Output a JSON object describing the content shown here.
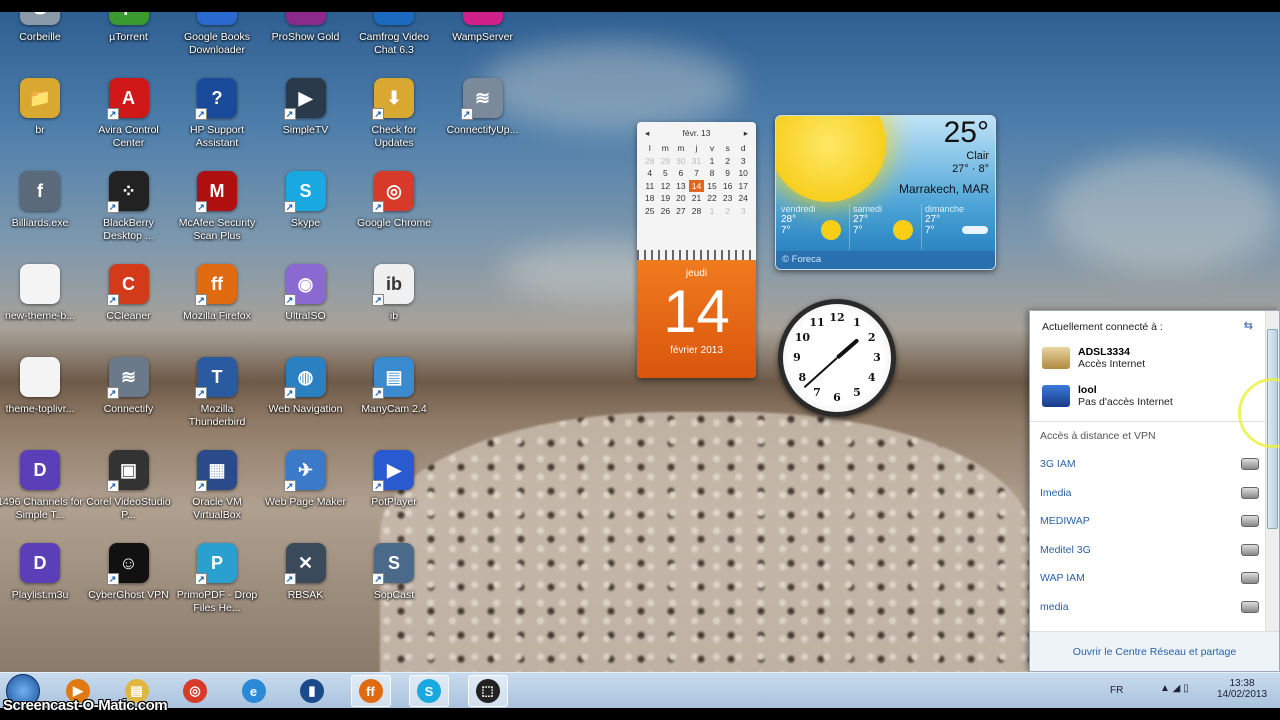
{
  "desktop": {
    "columns": [
      [
        {
          "label": "Corbeille",
          "glyph": "🗑",
          "color": "#8a9aa8"
        },
        {
          "label": "br",
          "glyph": "📁",
          "color": "#d9a830"
        },
        {
          "label": "Billiards.exe",
          "glyph": "f",
          "color": "#5a6a7a"
        },
        {
          "label": "new-theme-b...",
          "glyph": "",
          "color": "#f4f4f4"
        },
        {
          "label": "theme-toplivr...",
          "glyph": "",
          "color": "#f4f4f4"
        },
        {
          "label": "1496 Channels for Simple T...",
          "glyph": "D",
          "color": "#5b3fb8"
        },
        {
          "label": "Playlist.m3u",
          "glyph": "D",
          "color": "#5b3fb8"
        }
      ],
      [
        {
          "label": "µTorrent",
          "glyph": "µ",
          "color": "#3a9a30"
        },
        {
          "label": "Avira Control Center",
          "glyph": "A",
          "color": "#d01818"
        },
        {
          "label": "BlackBerry Desktop ...",
          "glyph": "⁘",
          "color": "#222"
        },
        {
          "label": "CCleaner",
          "glyph": "C",
          "color": "#d23a1a"
        },
        {
          "label": "Connectify",
          "glyph": "≋",
          "color": "#6a7a8a"
        },
        {
          "label": "Corel VideoStudio P...",
          "glyph": "▣",
          "color": "#333"
        },
        {
          "label": "CyberGhost VPN",
          "glyph": "☺",
          "color": "#111"
        }
      ],
      [
        {
          "label": "Google Books Downloader",
          "glyph": "G",
          "color": "#2a6ad0"
        },
        {
          "label": "HP Support Assistant",
          "glyph": "?",
          "color": "#1a4a9a"
        },
        {
          "label": "McAfee Security Scan Plus",
          "glyph": "M",
          "color": "#b01010"
        },
        {
          "label": "Mozilla Firefox",
          "glyph": "ff",
          "color": "#e06a10"
        },
        {
          "label": "Mozilla Thunderbird",
          "glyph": "T",
          "color": "#2a5aa0"
        },
        {
          "label": "Oracle VM VirtualBox",
          "glyph": "▦",
          "color": "#2a4a8a"
        },
        {
          "label": "PrimoPDF - Drop Files He...",
          "glyph": "P",
          "color": "#2aa0d0"
        }
      ],
      [
        {
          "label": "ProShow Gold",
          "glyph": "P",
          "color": "#8a2a8a"
        },
        {
          "label": "SimpleTV",
          "glyph": "▶",
          "color": "#2a3a4a"
        },
        {
          "label": "Skype",
          "glyph": "S",
          "color": "#19a8e0"
        },
        {
          "label": "UltraISO",
          "glyph": "◉",
          "color": "#8a6ad0"
        },
        {
          "label": "Web Navigation",
          "glyph": "◍",
          "color": "#2a80c0"
        },
        {
          "label": "Web Page Maker",
          "glyph": "✈",
          "color": "#3a7ac8"
        },
        {
          "label": "RBSAK",
          "glyph": "✕",
          "color": "#3a4a5a"
        }
      ],
      [
        {
          "label": "Camfrog Video Chat 6.3",
          "glyph": "C",
          "color": "#1a6ac0"
        },
        {
          "label": "Check for Updates",
          "glyph": "⬇",
          "color": "#d9a830"
        },
        {
          "label": "Google Chrome",
          "glyph": "◎",
          "color": "#d83a2a"
        },
        {
          "label": "ib",
          "glyph": "ib",
          "color": "#f0f0f0"
        },
        {
          "label": "ManyCam 2.4",
          "glyph": "▤",
          "color": "#3a8ad0"
        },
        {
          "label": "PotPlayer",
          "glyph": "▶",
          "color": "#2a5ad0"
        },
        {
          "label": "SopCast",
          "glyph": "S",
          "color": "#4a6a8a"
        }
      ],
      [
        {
          "label": "WampServer",
          "glyph": "W",
          "color": "#d0208a"
        },
        {
          "label": "ConnectifyUp...",
          "glyph": "≋",
          "color": "#7a8a9a"
        }
      ]
    ]
  },
  "calendar": {
    "month": "févr. 13",
    "weekdays": [
      "l",
      "m",
      "m",
      "j",
      "v",
      "s",
      "d"
    ],
    "weeks": [
      [
        "28",
        "29",
        "30",
        "31",
        "1",
        "2",
        "3"
      ],
      [
        "4",
        "5",
        "6",
        "7",
        "8",
        "9",
        "10"
      ],
      [
        "11",
        "12",
        "13",
        "14",
        "15",
        "16",
        "17"
      ],
      [
        "18",
        "19",
        "20",
        "21",
        "22",
        "23",
        "24"
      ],
      [
        "25",
        "26",
        "27",
        "28",
        "1",
        "2",
        "3"
      ]
    ],
    "today": "14",
    "weekday": "jeudi",
    "month_year": "février 2013",
    "accent": "#e2661c"
  },
  "weather": {
    "temp": "25°",
    "condition": "Clair",
    "hilo": "27° · 8°",
    "city": "Marrakech, MAR",
    "forecast": [
      {
        "day": "vendredi",
        "high": "28°",
        "low": "7°",
        "icon": "sun"
      },
      {
        "day": "samedi",
        "high": "27°",
        "low": "7°",
        "icon": "sun"
      },
      {
        "day": "dimanche",
        "high": "27°",
        "low": "7°",
        "icon": "wind"
      }
    ],
    "provider": "Foreca"
  },
  "clock": {
    "numbers": [
      "12",
      "1",
      "2",
      "3",
      "4",
      "5",
      "6",
      "7",
      "8",
      "9",
      "10",
      "11"
    ],
    "time": "13:38"
  },
  "network": {
    "connected_header": "Actuellement connecté à :",
    "connections": [
      {
        "name": "ADSL3334",
        "status": "Accès Internet"
      },
      {
        "name": "lool",
        "status": "Pas d'accès Internet"
      }
    ],
    "vpn_header": "Accès à distance et VPN",
    "vpn": [
      "3G IAM",
      "Imedia",
      "MEDIWAP",
      "Meditel 3G",
      "WAP IAM",
      "media"
    ],
    "footer_link": "Ouvrir le Centre Réseau et partage"
  },
  "taskbar": {
    "apps": [
      {
        "name": "media-player",
        "glyph": "▶",
        "color": "#e07a10"
      },
      {
        "name": "explorer",
        "glyph": "▤",
        "color": "#e0b840"
      },
      {
        "name": "chrome",
        "glyph": "◎",
        "color": "#d83a2a"
      },
      {
        "name": "internet-explorer",
        "glyph": "e",
        "color": "#2a8ad8"
      },
      {
        "name": "app",
        "glyph": "▮",
        "color": "#1a4a8a"
      },
      {
        "name": "firefox",
        "glyph": "ff",
        "color": "#e06a10",
        "active": true
      },
      {
        "name": "skype",
        "glyph": "S",
        "color": "#19a8e0",
        "active": true
      },
      {
        "name": "snipping",
        "glyph": "⬚",
        "color": "#222",
        "active": true
      }
    ],
    "language": "FR",
    "time": "13:38",
    "date": "14/02/2013"
  },
  "watermark": "Screencast-O-Matic.com"
}
